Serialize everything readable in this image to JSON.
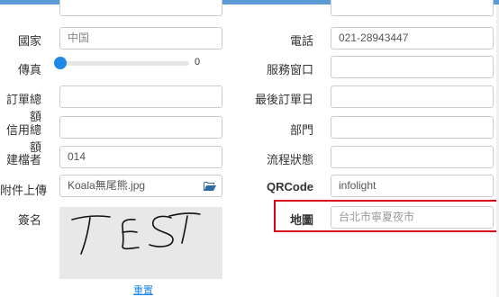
{
  "form": {
    "left": {
      "country_label": "國家",
      "country_value": "中国",
      "fax_label": "傳真",
      "fax_slider_value": "0",
      "fax_slider_level": 0,
      "order_total_label": "訂單總額",
      "order_total_value": "",
      "credit_total_label": "信用總額",
      "credit_total_value": "",
      "creator_label": "建檔者",
      "creator_value": "014",
      "attachment_label": "附件上傳",
      "attachment_value": "Koala無尾熊.jpg",
      "signature_label": "簽名",
      "signature_text": "TEST",
      "reset_label": "重置"
    },
    "right": {
      "phone_label": "電話",
      "phone_value": "021-28943447",
      "service_label": "服務窗口",
      "service_value": "",
      "last_order_label": "最後訂單日",
      "last_order_value": "",
      "department_label": "部門",
      "department_value": "",
      "workflow_label": "流程狀態",
      "workflow_value": "",
      "qrcode_label": "QRCode",
      "qrcode_value": "infolight",
      "map_label": "地圖",
      "map_placeholder": "台北市寧夏夜市"
    }
  },
  "colors": {
    "accent": "#1e88e5",
    "highlight_border": "#d9001b",
    "top_bar": "#5b9bd5"
  },
  "icons": {
    "folder": "folder-open-icon"
  }
}
